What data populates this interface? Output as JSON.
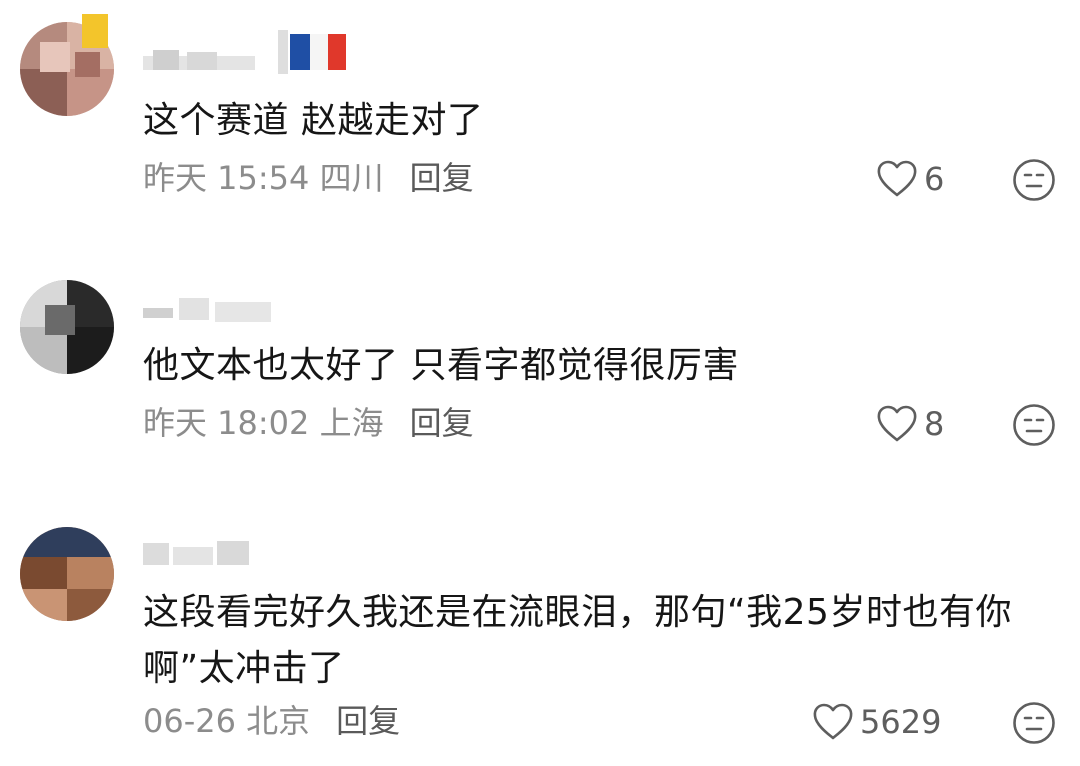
{
  "comments": [
    {
      "text": "这个赛道 赵越走对了",
      "meta": "昨天 15:54 四川",
      "reply_label": "回复",
      "likes": "6"
    },
    {
      "text": "他文本也太好了 只看字都觉得很厉害",
      "meta": "昨天 18:02 上海",
      "reply_label": "回复",
      "likes": "8"
    },
    {
      "text": "这段看完好久我还是在流眼泪，那句“我25岁时也有你啊”太冲击了",
      "meta": "06-26 北京",
      "reply_label": "回复",
      "likes": "5629"
    }
  ],
  "icons": {
    "like": "heart-outline-icon",
    "react": "neutral-face-icon",
    "badge": "france-flag-icon"
  },
  "colors": {
    "text": "#161616",
    "meta": "#8c8c8c",
    "icon": "#5e5e5e"
  }
}
